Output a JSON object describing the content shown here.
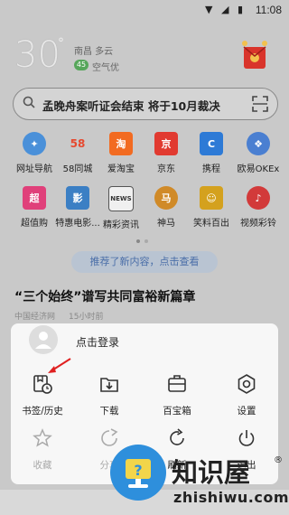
{
  "status": {
    "time": "11:08"
  },
  "weather": {
    "temp": "30",
    "deg": "°",
    "city_cond": "南昌  多云",
    "aqi_value": "45",
    "aqi_label": "空气优"
  },
  "search": {
    "text": "孟晚舟案听证会结束 将于10月裁决"
  },
  "apps": [
    {
      "label": "网址导航",
      "icon": "compass-icon",
      "color": "#4a90d9"
    },
    {
      "label": "58同城",
      "icon": "58-icon",
      "color": "#ffffff"
    },
    {
      "label": "爱淘宝",
      "icon": "taobao-icon",
      "color": "#f26b21"
    },
    {
      "label": "京东",
      "icon": "jd-icon",
      "color": "#e13a30"
    },
    {
      "label": "携程",
      "icon": "ctrip-icon",
      "color": "#2d7ad6"
    },
    {
      "label": "欧易OKEx",
      "icon": "okex-icon",
      "color": "#4a7fd1"
    },
    {
      "label": "超值购",
      "icon": "chaozhigou-icon",
      "color": "#e0407a"
    },
    {
      "label": "特惠电影...",
      "icon": "movie-icon",
      "color": "#3b7fc4"
    },
    {
      "label": "精彩资讯",
      "icon": "news-icon",
      "color": "#444444"
    },
    {
      "label": "神马",
      "icon": "shenma-icon",
      "color": "#d08a28"
    },
    {
      "label": "笑料百出",
      "icon": "laugh-icon",
      "color": "#d4a11e"
    },
    {
      "label": "视频彩铃",
      "icon": "ringtone-icon",
      "color": "#d23a3a"
    }
  ],
  "notify": "推荐了新内容，点击查看",
  "feed": {
    "headline": "“三个始终”谱写共同富裕新篇章",
    "source": "中国经济网",
    "time": "15小时前"
  },
  "menu": {
    "login": "点击登录",
    "items": [
      {
        "label": "书签/历史",
        "icon": "bookmark-history-icon",
        "enabled": true
      },
      {
        "label": "下载",
        "icon": "download-icon",
        "enabled": true
      },
      {
        "label": "百宝箱",
        "icon": "toolbox-icon",
        "enabled": true
      },
      {
        "label": "设置",
        "icon": "settings-icon",
        "enabled": true
      },
      {
        "label": "收藏",
        "icon": "star-icon",
        "enabled": false
      },
      {
        "label": "分享",
        "icon": "share-icon",
        "enabled": false
      },
      {
        "label": "刷新",
        "icon": "refresh-icon",
        "enabled": true
      },
      {
        "label": "退出",
        "icon": "power-icon",
        "enabled": true
      }
    ]
  },
  "watermark": {
    "title": "知识屋",
    "reg": "®",
    "url": "zhishiwu.com"
  }
}
